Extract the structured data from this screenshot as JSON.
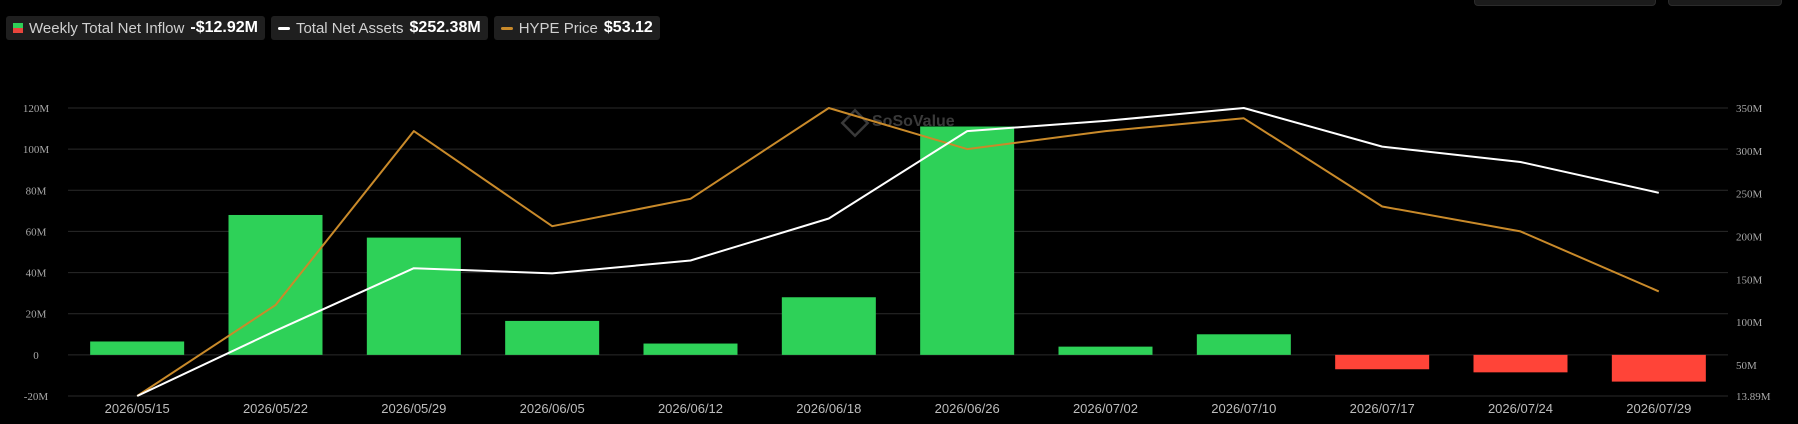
{
  "legend": {
    "inflow": {
      "label": "Weekly Total Net Inflow",
      "value": "-$12.92M"
    },
    "assets": {
      "label": "Total Net Assets",
      "value": "$252.38M"
    },
    "price": {
      "label": "HYPE Price",
      "value": "$53.12"
    }
  },
  "watermark": "SoSoValue",
  "colors": {
    "positive": "#2ed158",
    "negative": "#ff4438",
    "assets_line": "#ffffff",
    "price_line": "#c98a2a",
    "grid": "#2a2a2a"
  },
  "chart_data": {
    "type": "bar",
    "categories": [
      "2026/05/15",
      "2026/05/22",
      "2026/05/29",
      "2026/06/05",
      "2026/06/12",
      "2026/06/18",
      "2026/06/26",
      "2026/07/02",
      "2026/07/10",
      "2026/07/17",
      "2026/07/24",
      "2026/07/29"
    ],
    "left_axis": {
      "ylim": [
        -20,
        120
      ],
      "ticks": [
        -20,
        0,
        20,
        40,
        60,
        80,
        100,
        120
      ],
      "tick_labels": [
        "-20M",
        "0",
        "20M",
        "40M",
        "60M",
        "80M",
        "100M",
        "120M"
      ]
    },
    "right_axis": {
      "ylim": [
        13.89,
        350
      ],
      "ticks": [
        13.89,
        50,
        100,
        150,
        200,
        250,
        300,
        350
      ],
      "tick_labels": [
        "13.89M",
        "50M",
        "100M",
        "150M",
        "200M",
        "250M",
        "300M",
        "350M"
      ]
    },
    "series": [
      {
        "name": "Weekly Total Net Inflow",
        "kind": "bar",
        "axis": "left",
        "values": [
          6.5,
          68,
          57,
          16.5,
          5.5,
          28,
          111,
          4,
          10,
          -7,
          -8.5,
          -13
        ]
      },
      {
        "name": "Total Net Assets",
        "kind": "line",
        "axis": "right",
        "values": [
          13.89,
          90,
          163,
          157,
          172,
          221,
          323,
          335,
          350,
          305,
          287,
          251
        ]
      },
      {
        "name": "HYPE Price",
        "kind": "line",
        "axis": "right",
        "values": [
          13.89,
          120,
          323,
          212,
          244,
          350,
          302,
          323,
          338,
          235,
          206,
          136
        ]
      }
    ],
    "grid": true
  }
}
